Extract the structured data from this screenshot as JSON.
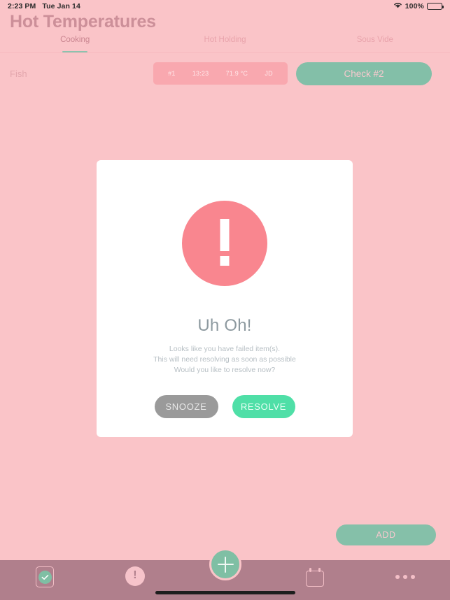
{
  "status_bar": {
    "time": "2:23 PM",
    "date": "Tue Jan 14",
    "wifi_icon": "wifi-icon",
    "battery_percent": "100%",
    "battery_icon": "battery-full-icon"
  },
  "header": {
    "title": "Hot Temperatures",
    "tabs": [
      {
        "label": "Cooking",
        "active": true
      },
      {
        "label": "Hot Holding",
        "active": false
      },
      {
        "label": "Sous Vide",
        "active": false
      }
    ]
  },
  "item_row": {
    "name": "Fish",
    "reading": {
      "check_number": "#1",
      "time": "13:23",
      "temperature": "71.9 °C",
      "initials": "JD"
    },
    "check_button_label": "Check #2"
  },
  "modal": {
    "alert_icon": "exclamation-circle-icon",
    "title": "Uh Oh!",
    "body": "Looks like you have failed item(s).\nThis will need resolving as soon as possible\nWould  you like to resolve now?",
    "snooze_label": "SNOOZE",
    "resolve_label": "RESOLVE"
  },
  "add_button": {
    "label": "ADD"
  },
  "bottom_nav": {
    "items": [
      {
        "icon": "clipboard-check-icon",
        "name": "checks"
      },
      {
        "icon": "alert-circle-icon",
        "name": "alerts"
      },
      {
        "icon": "plus-icon",
        "name": "add-fab"
      },
      {
        "icon": "calendar-icon",
        "name": "calendar"
      },
      {
        "icon": "ellipsis-icon",
        "name": "more"
      }
    ]
  },
  "colors": {
    "background_pink": "#fac4c8",
    "title_pink": "#cc8f99",
    "chip_pink": "#f9a8af",
    "sage_green": "#83bfa8",
    "mint_green": "#4fdfa7",
    "alert_red": "#f9868f",
    "snooze_gray": "#9a9a9a",
    "bottom_bar": "#b07f8c",
    "tab_underline": "#8cc3ae"
  }
}
